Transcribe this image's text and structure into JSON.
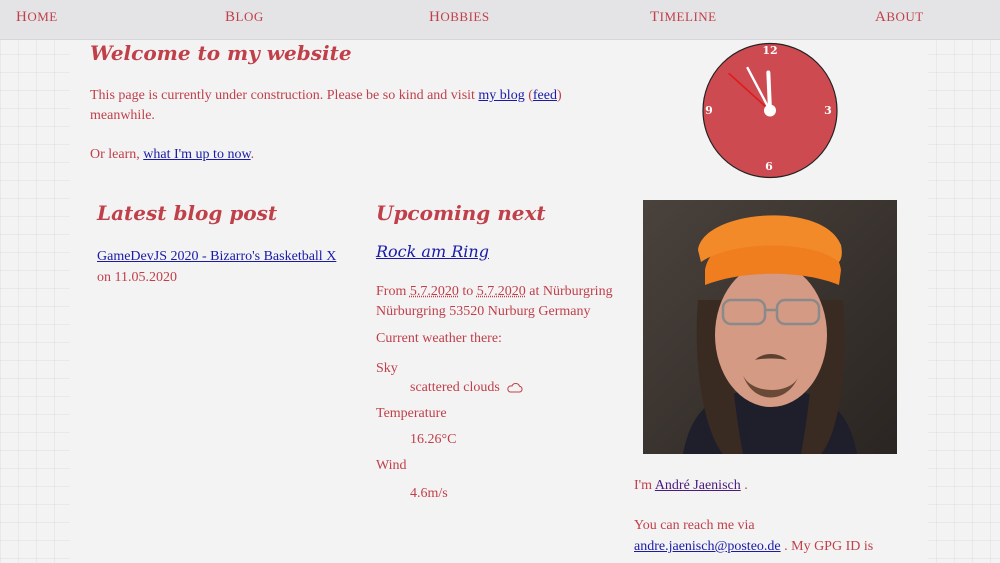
{
  "nav": {
    "home": {
      "first": "H",
      "rest": "OME"
    },
    "blog": {
      "first": "B",
      "rest": "LOG"
    },
    "hobbies": {
      "first": "H",
      "rest": "OBBIES"
    },
    "timeline": {
      "first": "T",
      "rest": "IMELINE"
    },
    "about": {
      "first": "A",
      "rest": "BOUT"
    }
  },
  "welcome": {
    "title": "Welcome to my website",
    "line1_pre": "This page is currently under construction. Please be so kind and visit ",
    "blog_link": "my blog",
    "paren_open": " (",
    "feed_link": "feed",
    "paren_close": ")",
    "line1_post": " meanwhile.",
    "learn_pre": "Or learn, ",
    "learn_link": "what I'm up to now",
    "learn_post": "."
  },
  "clock": {
    "face_color": "#cd4a50",
    "numbers": {
      "twelve": "12",
      "three": "3",
      "six": "6",
      "nine": "9"
    },
    "time": {
      "hour": 11,
      "minute": 55,
      "second": 22
    }
  },
  "latest_blog": {
    "heading": "Latest blog post",
    "post_title": "GameDevJS 2020 - Bizarro's Basketball X",
    "date_pre": "on ",
    "date": "11.05.2020"
  },
  "upcoming": {
    "heading": "Upcoming next",
    "event_name": "Rock am Ring",
    "from_label": "From ",
    "start_date": "5.7.2020",
    "to_label": " to ",
    "end_date": "5.7.2020",
    "at_label": " at Nürburgring",
    "address": "Nürburgring 53520 Nurburg Germany",
    "weather_heading": "Current weather there:",
    "sky_label": "Sky",
    "sky_value": "scattered clouds",
    "sky_icon": "cloud-icon",
    "temp_label": "Temperature",
    "temp_value": "16.26°C",
    "wind_label": "Wind",
    "wind_value": "4.6m/s"
  },
  "about": {
    "im": "I'm ",
    "name": "André Jaenisch",
    "period": " .",
    "reach": "You can reach me via",
    "email": "andre.jaenisch@posteo.de",
    "gpg_pre": " . My GPG ID is"
  },
  "colors": {
    "accent": "#c0404a",
    "link": "#1a1aa6",
    "nav_bg": "#e4e4e6",
    "background": "#f3f3f4"
  }
}
